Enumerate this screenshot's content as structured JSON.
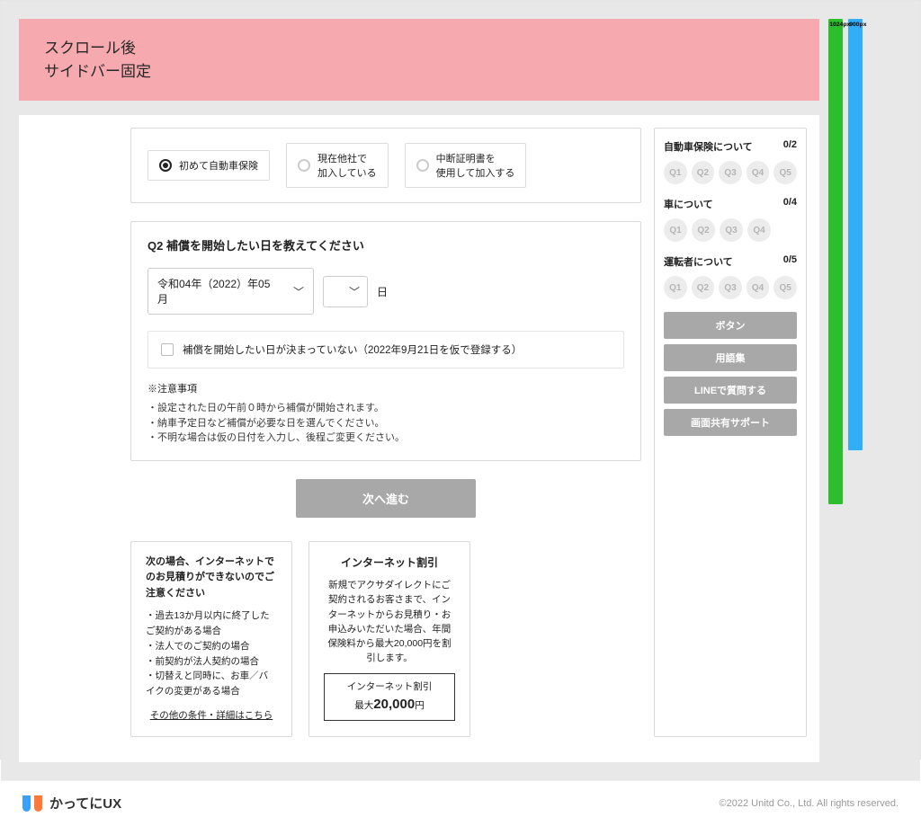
{
  "banner": {
    "line1": "スクロール後",
    "line2": "サイドバー固定"
  },
  "rulers": {
    "green": "1024px",
    "blue": "900px"
  },
  "options": {
    "o1": "初めて自動車保険",
    "o2a": "現在他社で",
    "o2b": "加入している",
    "o3a": "中断証明書を",
    "o3b": "使用して加入する"
  },
  "q2": {
    "title": "Q2  補償を開始したい日を教えてください",
    "month_value": "令和04年（2022）年05月",
    "day_suffix": "日",
    "checkbox": "補償を開始したい日が決まっていない（2022年9月21日を仮で登録する）",
    "note_head": "※注意事項",
    "n1": "・設定された日の午前０時から補償が開始されます。",
    "n2": "・納車予定日など補償が必要な日を選んでください。",
    "n3": "・不明な場合は仮の日付を入力し、後程ご変更ください。"
  },
  "next_btn": "次へ進む",
  "warn": {
    "title": "次の場合、インターネットでのお見積りができないのでご注意ください",
    "i1": "過去13か月以内に終了したご契約がある場合",
    "i2": "法人でのご契約の場合",
    "i3": "前契約が法人契約の場合",
    "i4": "切替えと同時に、お車／バイクの変更がある場合",
    "more": "その他の条件・詳細はこちら"
  },
  "promo": {
    "title": "インターネット割引",
    "body": "新規でアクサダイレクトにご契約されるお客さまで、インターネットからお見積り・お申込みいただいた場合、年間保険料から最大20,000円を割引します。",
    "box_line1": "インターネット割引",
    "box_prefix": "最大",
    "box_amount": "20,000",
    "box_suffix": "円"
  },
  "sidebar": {
    "s1": {
      "title": "自動車保険について",
      "count": "0/2",
      "q": [
        "Q1",
        "Q2",
        "Q3",
        "Q4",
        "Q5"
      ]
    },
    "s2": {
      "title": "車について",
      "count": "0/4",
      "q": [
        "Q1",
        "Q2",
        "Q3",
        "Q4"
      ]
    },
    "s3": {
      "title": "運転者について",
      "count": "0/5",
      "q": [
        "Q1",
        "Q2",
        "Q3",
        "Q4",
        "Q5"
      ]
    },
    "b1": "ボタン",
    "b2": "用語集",
    "b3": "LINEで質問する",
    "b4": "画面共有サポート"
  },
  "footer": {
    "brand": "かってにUX",
    "copy": "©2022 Unitd Co., Ltd. All rights reserved."
  }
}
